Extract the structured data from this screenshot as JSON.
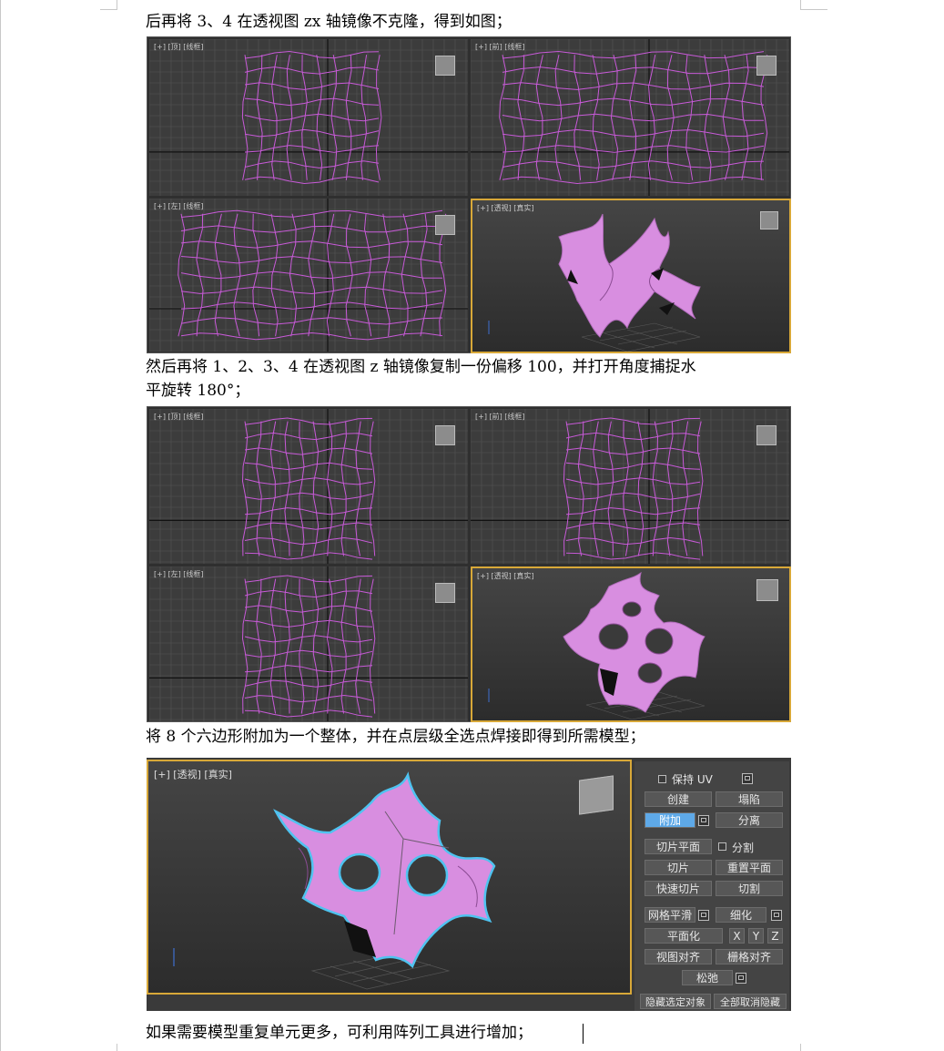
{
  "paragraphs": {
    "p1": "后再将 3、4 在透视图 zx 轴镜像不克隆，得到如图；",
    "p2_line1": "然后再将 1、2、3、4 在透视图 z 轴镜像复制一份偏移 100，并打开角度捕捉水",
    "p2_line2": "平旋转 180°；",
    "p3": "将 8 个六边形附加为一个整体，并在点层级全选点焊接即得到所需模型；",
    "p4": "如果需要模型重复单元更多，可利用阵列工具进行增加；"
  },
  "figure1": {
    "vp_top": "[+] [顶] [线框]",
    "vp_front": "[+] [前] [线框]",
    "vp_left": "[+] [左] [线框]",
    "vp_persp": "[+] [透视] [真实]"
  },
  "figure2": {
    "vp_top": "[+] [顶] [线框]",
    "vp_front": "[+] [前] [线框]",
    "vp_left": "[+] [左] [线框]",
    "vp_persp": "[+] [透视] [真实]"
  },
  "figure3": {
    "vp_persp": "[+] [透视] [真实]",
    "panel": {
      "keep_uv": "保持 UV",
      "create": "创建",
      "collapse": "塌陷",
      "attach": "附加",
      "detach": "分离",
      "slice_plane": "切片平面",
      "split": "分割",
      "slice": "切片",
      "reset_plane": "重置平面",
      "quick_slice": "快速切片",
      "cut": "切割",
      "mesh_smooth": "网格平滑",
      "tessellate": "细化",
      "make_planar": "平面化",
      "x": "X",
      "y": "Y",
      "z": "Z",
      "view_align": "视图对齐",
      "grid_align": "栅格对齐",
      "relax": "松弛",
      "hide_selected": "隐藏选定对象",
      "unhide_all": "全部取消隐藏"
    }
  },
  "colors": {
    "wire": "#c85ad8",
    "shape_fill": "#d88ee0",
    "active_border": "#d8a838",
    "selection_outline": "#4fc3f0"
  }
}
